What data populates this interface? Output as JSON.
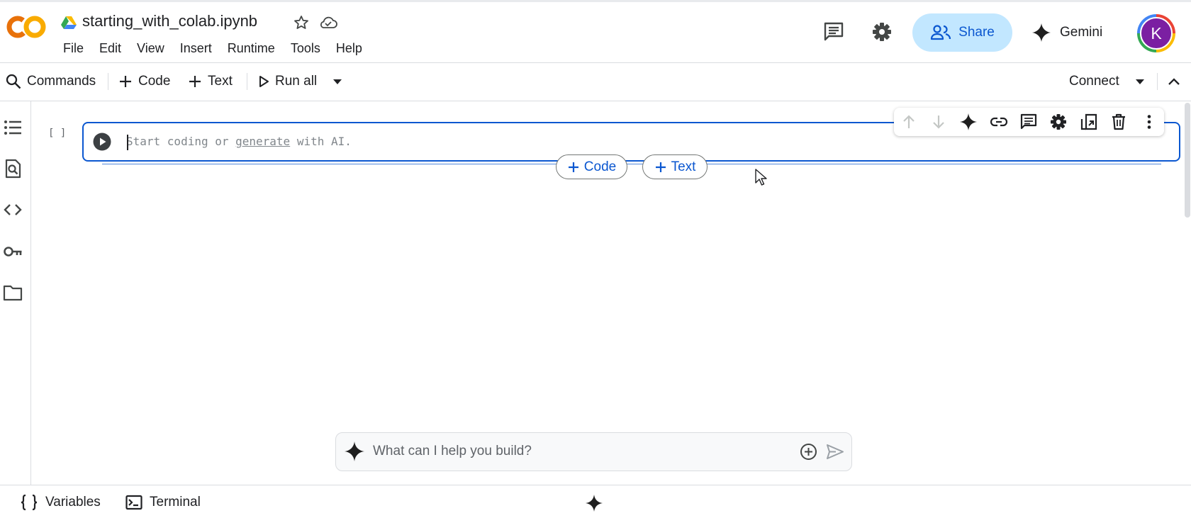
{
  "header": {
    "notebook_title": "starting_with_colab.ipynb",
    "logo_text": "CO",
    "menu": [
      "File",
      "Edit",
      "View",
      "Insert",
      "Runtime",
      "Tools",
      "Help"
    ],
    "share_label": "Share",
    "gemini_label": "Gemini",
    "avatar_initial": "K"
  },
  "toolbar": {
    "commands_label": "Commands",
    "add_code_label": "Code",
    "add_text_label": "Text",
    "run_all_label": "Run all",
    "connect_label": "Connect"
  },
  "sidebar": {
    "icons": [
      "table-of-contents-icon",
      "find-replace-icon",
      "code-snippets-icon",
      "secrets-key-icon",
      "files-folder-icon"
    ]
  },
  "cell": {
    "execution_count": "[ ]",
    "placeholder_prefix": "Start coding or ",
    "placeholder_link": "generate",
    "placeholder_suffix": " with AI.",
    "toolbar_icons": [
      "move-up-icon",
      "move-down-icon",
      "gemini-spark-icon",
      "link-icon",
      "comment-icon",
      "settings-icon",
      "mirror-cell-icon",
      "delete-icon",
      "more-vert-icon"
    ]
  },
  "add_cell": {
    "code_label": "Code",
    "text_label": "Text"
  },
  "prompt": {
    "placeholder": "What can I help you build?"
  },
  "statusbar": {
    "variables_label": "Variables",
    "terminal_label": "Terminal"
  },
  "colors": {
    "accent": "#0b57d0",
    "share_bg": "#c2e7ff",
    "avatar_bg": "#7b1fa2",
    "logo_orange": "#f9ab00"
  }
}
